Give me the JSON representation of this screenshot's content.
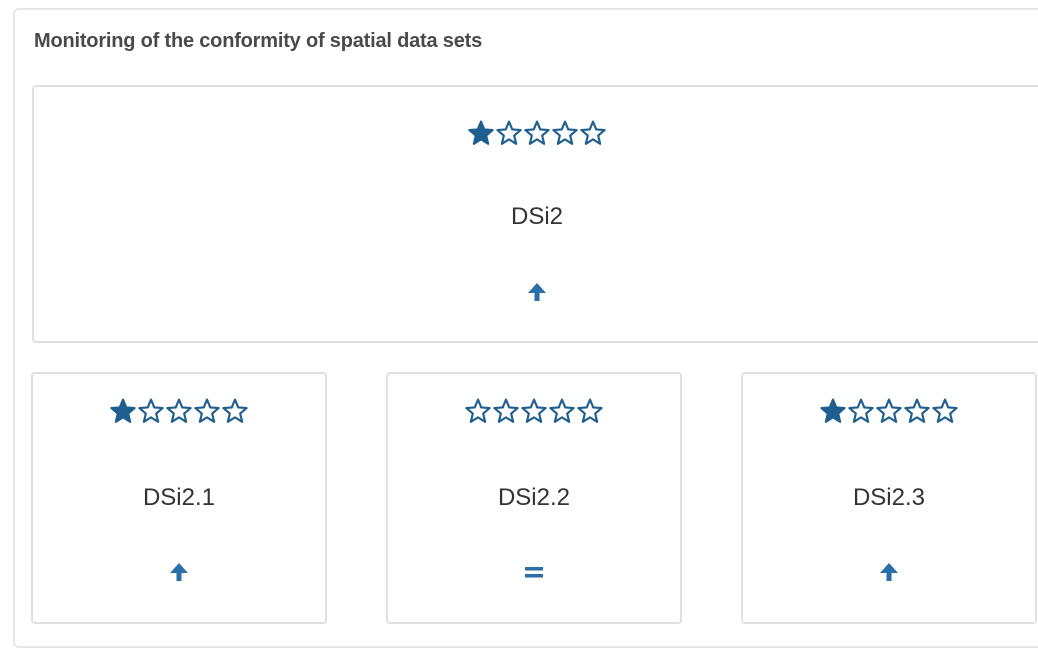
{
  "panel": {
    "title": "Monitoring of the conformity of spatial data sets"
  },
  "colors": {
    "star": "#1f5f8f",
    "trend": "#2a6fa8",
    "text": "#333333"
  },
  "main_indicator": {
    "label": "DSi2",
    "stars_filled": 1,
    "stars_total": 5,
    "trend": "up-arrow-icon"
  },
  "sub_indicators": [
    {
      "label": "DSi2.1",
      "stars_filled": 1,
      "stars_total": 5,
      "trend": "up-arrow-icon"
    },
    {
      "label": "DSi2.2",
      "stars_filled": 0,
      "stars_total": 5,
      "trend": "equals-icon"
    },
    {
      "label": "DSi2.3",
      "stars_filled": 1,
      "stars_total": 5,
      "trend": "up-arrow-icon"
    }
  ]
}
